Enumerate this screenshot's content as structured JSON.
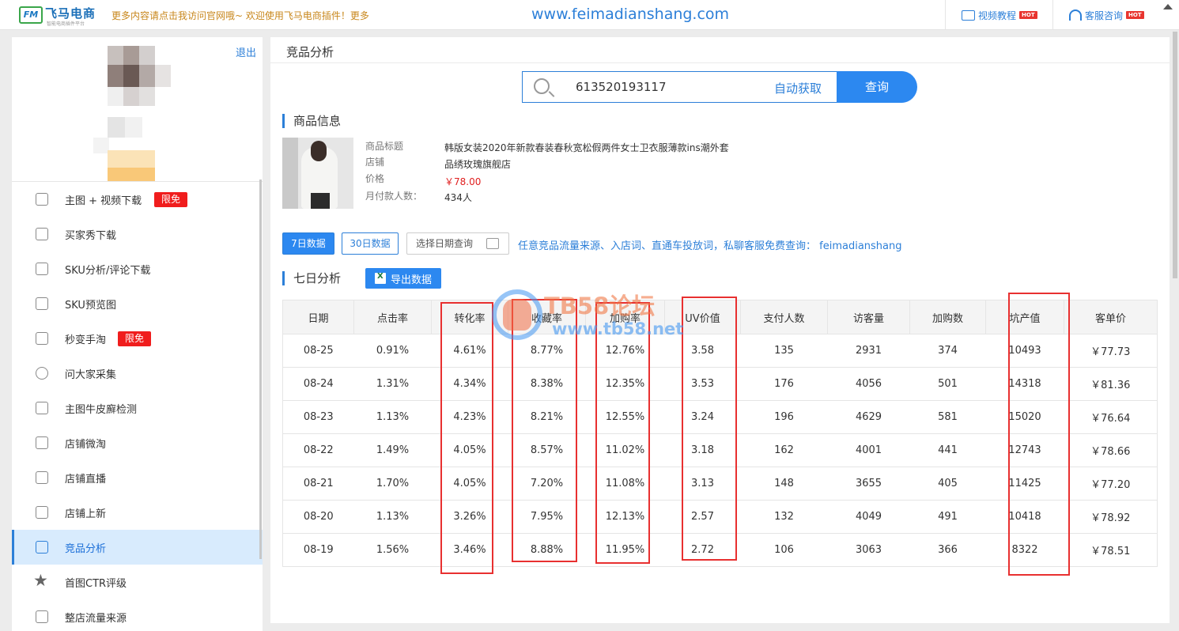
{
  "topbar": {
    "logo_mark": "FM",
    "logo_text": "飞马电商",
    "logo_sub": "智能电商插件平台",
    "notice": "更多内容请点击我访问官网哦~ 欢迎使用飞马电商插件！更多",
    "site_url": "www.feimadianshang.com",
    "video_tutorial": "视频教程",
    "customer_service": "客服咨询",
    "hot": "HOT"
  },
  "sidebar": {
    "logout": "退出",
    "menu": [
      {
        "label": "主图 + 视频下载",
        "icon": "image-icon",
        "badge": "限免"
      },
      {
        "label": "买家秀下载",
        "icon": "camera-icon",
        "badge": ""
      },
      {
        "label": "SKU分析/评论下载",
        "icon": "comment-icon",
        "badge": ""
      },
      {
        "label": "SKU预览图",
        "icon": "preview-icon",
        "badge": ""
      },
      {
        "label": "秒变手淘",
        "icon": "phone-icon",
        "badge": "限免"
      },
      {
        "label": "问大家采集",
        "icon": "question-icon",
        "badge": ""
      },
      {
        "label": "主图牛皮廯检测",
        "icon": "wave-icon",
        "badge": ""
      },
      {
        "label": "店铺微淘",
        "icon": "shop-icon",
        "badge": ""
      },
      {
        "label": "店铺直播",
        "icon": "tv-icon",
        "badge": ""
      },
      {
        "label": "店铺上新",
        "icon": "upload-icon",
        "badge": ""
      },
      {
        "label": "竞品分析",
        "icon": "analysis-icon",
        "badge": "",
        "active": true
      },
      {
        "label": "首图CTR评级",
        "icon": "star-icon",
        "badge": ""
      },
      {
        "label": "整店流量来源",
        "icon": "flow-icon",
        "badge": ""
      }
    ]
  },
  "main": {
    "title": "竞品分析",
    "search": {
      "value": "613520193117",
      "auto_get": "自动获取",
      "button": "查询"
    },
    "product_section": "商品信息",
    "product": {
      "title_label": "商品标题",
      "title": "韩版女装2020年新款春装春秋宽松假两件女士卫衣服薄款ins潮外套",
      "shop_label": "店铺",
      "shop": "品绣玫瑰旗舰店",
      "price_label": "价格",
      "price": "￥78.00",
      "monthly_label": "月付款人数：",
      "monthly": "434人"
    },
    "tabs": {
      "seven_day": "7日数据",
      "thirty_day": "30日数据",
      "date_query": "选择日期查询"
    },
    "promo": "任意竞品流量来源、入店词、直通车投放词，私聊客服免费查询： feimadianshang",
    "analysis_section": "七日分析",
    "export": "导出数据",
    "table": {
      "headers": [
        "日期",
        "点击率",
        "转化率",
        "收藏率",
        "加购率",
        "UV价值",
        "支付人数",
        "访客量",
        "加购数",
        "坑产值",
        "客单价"
      ],
      "rows": [
        [
          "08-25",
          "0.91%",
          "4.61%",
          "8.77%",
          "12.76%",
          "3.58",
          "135",
          "2931",
          "374",
          "10493",
          "￥77.73"
        ],
        [
          "08-24",
          "1.31%",
          "4.34%",
          "8.38%",
          "12.35%",
          "3.53",
          "176",
          "4056",
          "501",
          "14318",
          "￥81.36"
        ],
        [
          "08-23",
          "1.13%",
          "4.23%",
          "8.21%",
          "12.55%",
          "3.24",
          "196",
          "4629",
          "581",
          "15020",
          "￥76.64"
        ],
        [
          "08-22",
          "1.49%",
          "4.05%",
          "8.57%",
          "11.02%",
          "3.18",
          "162",
          "4001",
          "441",
          "12743",
          "￥78.66"
        ],
        [
          "08-21",
          "1.70%",
          "4.05%",
          "7.20%",
          "11.08%",
          "3.13",
          "148",
          "3655",
          "405",
          "11425",
          "￥77.20"
        ],
        [
          "08-20",
          "1.13%",
          "3.26%",
          "7.95%",
          "12.13%",
          "2.57",
          "132",
          "4049",
          "491",
          "10418",
          "￥78.92"
        ],
        [
          "08-19",
          "1.56%",
          "3.46%",
          "8.88%",
          "11.95%",
          "2.72",
          "106",
          "3063",
          "366",
          "8322",
          "￥78.51"
        ]
      ]
    }
  },
  "watermark": {
    "top": "TB58论坛",
    "bottom": "www.tb58.net"
  },
  "colors": {
    "accent": "#2c88f0",
    "badge": "#f01d1d",
    "annotation": "#e83030"
  }
}
